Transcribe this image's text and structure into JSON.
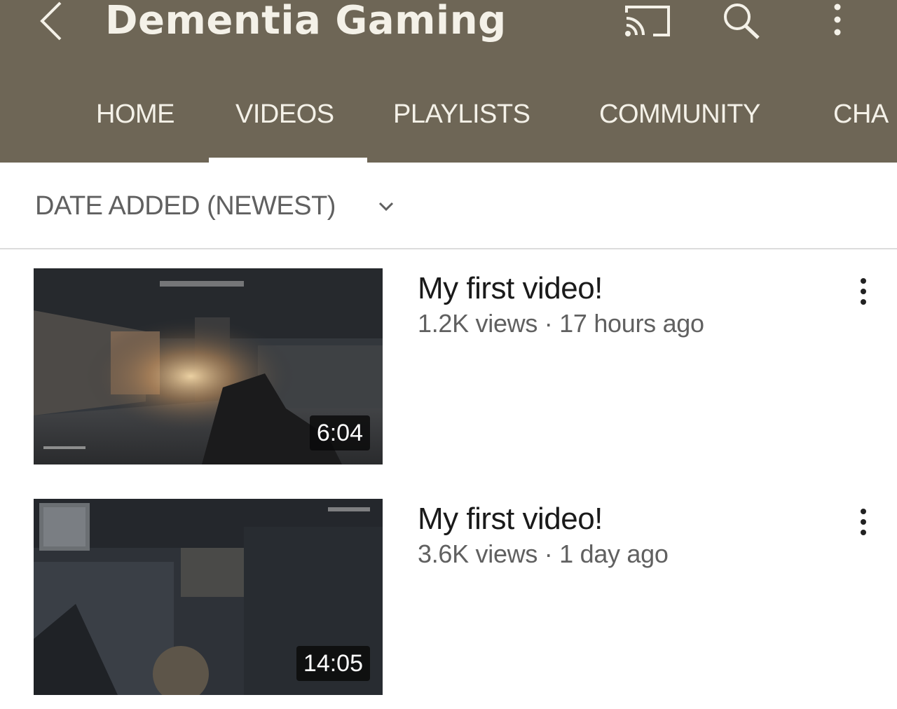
{
  "header": {
    "channel_name": "Dementia Gaming",
    "background_color": "#6e6656",
    "text_color": "#f4f1e8",
    "icons": [
      "back-arrow-icon",
      "cast-icon",
      "search-icon",
      "more-vert-icon"
    ]
  },
  "tabs": [
    {
      "label": "HOME",
      "selected": false
    },
    {
      "label": "VIDEOS",
      "selected": true
    },
    {
      "label": "PLAYLISTS",
      "selected": false
    },
    {
      "label": "COMMUNITY",
      "selected": false
    },
    {
      "label": "CHA",
      "selected": false
    }
  ],
  "sort": {
    "label": "DATE ADDED (NEWEST)",
    "icon": "chevron-down-icon"
  },
  "videos": [
    {
      "title": "My first video!",
      "meta": "1.2K views · 17 hours ago",
      "duration": "6:04"
    },
    {
      "title": "My first video!",
      "meta": "3.6K views · 1 day ago",
      "duration": "14:05"
    }
  ]
}
